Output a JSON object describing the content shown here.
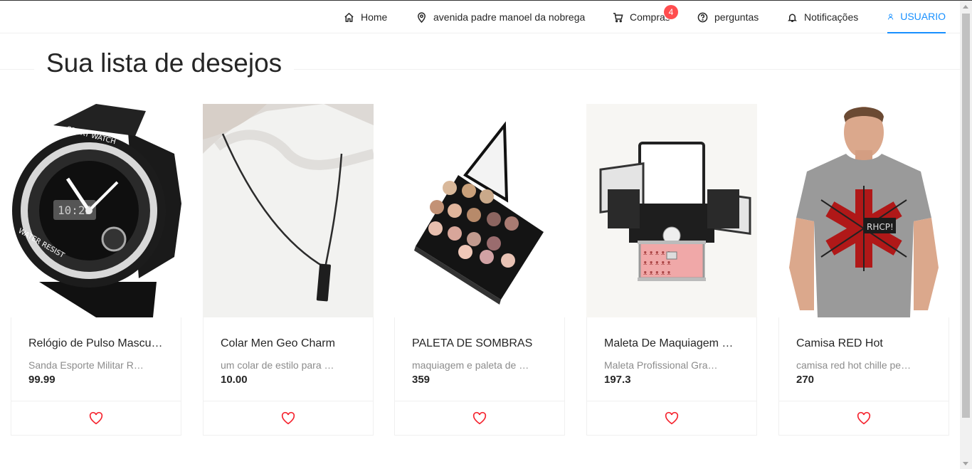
{
  "nav": {
    "items": [
      {
        "label": "Home",
        "icon": "home-icon"
      },
      {
        "label": "avenida padre manoel da nobrega",
        "icon": "location-icon"
      },
      {
        "label": "Compras",
        "icon": "cart-icon",
        "badge": "4"
      },
      {
        "label": "perguntas",
        "icon": "question-icon"
      },
      {
        "label": "Notificações",
        "icon": "bell-icon"
      },
      {
        "label": "USUARIO",
        "icon": "user-icon",
        "active": true
      }
    ]
  },
  "page": {
    "title": "Sua lista de desejos"
  },
  "products": [
    {
      "name": "Relógio de Pulso Masculino",
      "description": "Sanda Esporte Militar Relógio",
      "price": "99.99",
      "image": "sport-watch"
    },
    {
      "name": "Colar Men Geo Charm",
      "description": "um colar de estilo para homens",
      "price": "10.00",
      "image": "necklace"
    },
    {
      "name": "PALETA DE SOMBRAS",
      "description": "maquiagem e paleta de sombras",
      "price": "359",
      "image": "eyeshadow-palette"
    },
    {
      "name": "Maleta De Maquiagem Completa",
      "description": "Maleta Profissional Grande",
      "price": "197.3",
      "image": "makeup-case"
    },
    {
      "name": "Camisa RED Hot",
      "description": "camisa red hot chille peppers",
      "price": "270",
      "image": "rhcp-shirt"
    }
  ],
  "colors": {
    "accent": "#1890ff",
    "heart": "#f5222d",
    "badge": "#ff4d4f"
  }
}
